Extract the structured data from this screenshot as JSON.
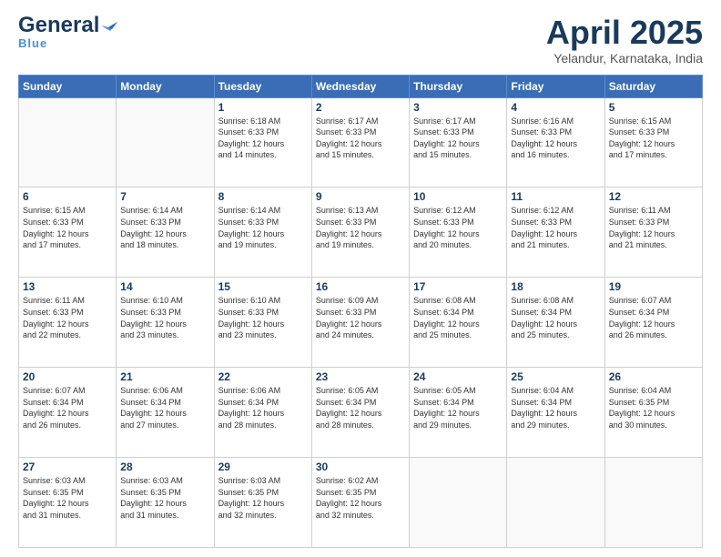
{
  "header": {
    "logo_line1": "General",
    "logo_line2": "Blue",
    "title": "April 2025",
    "subtitle": "Yelandur, Karnataka, India"
  },
  "weekdays": [
    "Sunday",
    "Monday",
    "Tuesday",
    "Wednesday",
    "Thursday",
    "Friday",
    "Saturday"
  ],
  "weeks": [
    [
      {
        "day": "",
        "info": ""
      },
      {
        "day": "",
        "info": ""
      },
      {
        "day": "1",
        "info": "Sunrise: 6:18 AM\nSunset: 6:33 PM\nDaylight: 12 hours\nand 14 minutes."
      },
      {
        "day": "2",
        "info": "Sunrise: 6:17 AM\nSunset: 6:33 PM\nDaylight: 12 hours\nand 15 minutes."
      },
      {
        "day": "3",
        "info": "Sunrise: 6:17 AM\nSunset: 6:33 PM\nDaylight: 12 hours\nand 15 minutes."
      },
      {
        "day": "4",
        "info": "Sunrise: 6:16 AM\nSunset: 6:33 PM\nDaylight: 12 hours\nand 16 minutes."
      },
      {
        "day": "5",
        "info": "Sunrise: 6:15 AM\nSunset: 6:33 PM\nDaylight: 12 hours\nand 17 minutes."
      }
    ],
    [
      {
        "day": "6",
        "info": "Sunrise: 6:15 AM\nSunset: 6:33 PM\nDaylight: 12 hours\nand 17 minutes."
      },
      {
        "day": "7",
        "info": "Sunrise: 6:14 AM\nSunset: 6:33 PM\nDaylight: 12 hours\nand 18 minutes."
      },
      {
        "day": "8",
        "info": "Sunrise: 6:14 AM\nSunset: 6:33 PM\nDaylight: 12 hours\nand 19 minutes."
      },
      {
        "day": "9",
        "info": "Sunrise: 6:13 AM\nSunset: 6:33 PM\nDaylight: 12 hours\nand 19 minutes."
      },
      {
        "day": "10",
        "info": "Sunrise: 6:12 AM\nSunset: 6:33 PM\nDaylight: 12 hours\nand 20 minutes."
      },
      {
        "day": "11",
        "info": "Sunrise: 6:12 AM\nSunset: 6:33 PM\nDaylight: 12 hours\nand 21 minutes."
      },
      {
        "day": "12",
        "info": "Sunrise: 6:11 AM\nSunset: 6:33 PM\nDaylight: 12 hours\nand 21 minutes."
      }
    ],
    [
      {
        "day": "13",
        "info": "Sunrise: 6:11 AM\nSunset: 6:33 PM\nDaylight: 12 hours\nand 22 minutes."
      },
      {
        "day": "14",
        "info": "Sunrise: 6:10 AM\nSunset: 6:33 PM\nDaylight: 12 hours\nand 23 minutes."
      },
      {
        "day": "15",
        "info": "Sunrise: 6:10 AM\nSunset: 6:33 PM\nDaylight: 12 hours\nand 23 minutes."
      },
      {
        "day": "16",
        "info": "Sunrise: 6:09 AM\nSunset: 6:33 PM\nDaylight: 12 hours\nand 24 minutes."
      },
      {
        "day": "17",
        "info": "Sunrise: 6:08 AM\nSunset: 6:34 PM\nDaylight: 12 hours\nand 25 minutes."
      },
      {
        "day": "18",
        "info": "Sunrise: 6:08 AM\nSunset: 6:34 PM\nDaylight: 12 hours\nand 25 minutes."
      },
      {
        "day": "19",
        "info": "Sunrise: 6:07 AM\nSunset: 6:34 PM\nDaylight: 12 hours\nand 26 minutes."
      }
    ],
    [
      {
        "day": "20",
        "info": "Sunrise: 6:07 AM\nSunset: 6:34 PM\nDaylight: 12 hours\nand 26 minutes."
      },
      {
        "day": "21",
        "info": "Sunrise: 6:06 AM\nSunset: 6:34 PM\nDaylight: 12 hours\nand 27 minutes."
      },
      {
        "day": "22",
        "info": "Sunrise: 6:06 AM\nSunset: 6:34 PM\nDaylight: 12 hours\nand 28 minutes."
      },
      {
        "day": "23",
        "info": "Sunrise: 6:05 AM\nSunset: 6:34 PM\nDaylight: 12 hours\nand 28 minutes."
      },
      {
        "day": "24",
        "info": "Sunrise: 6:05 AM\nSunset: 6:34 PM\nDaylight: 12 hours\nand 29 minutes."
      },
      {
        "day": "25",
        "info": "Sunrise: 6:04 AM\nSunset: 6:34 PM\nDaylight: 12 hours\nand 29 minutes."
      },
      {
        "day": "26",
        "info": "Sunrise: 6:04 AM\nSunset: 6:35 PM\nDaylight: 12 hours\nand 30 minutes."
      }
    ],
    [
      {
        "day": "27",
        "info": "Sunrise: 6:03 AM\nSunset: 6:35 PM\nDaylight: 12 hours\nand 31 minutes."
      },
      {
        "day": "28",
        "info": "Sunrise: 6:03 AM\nSunset: 6:35 PM\nDaylight: 12 hours\nand 31 minutes."
      },
      {
        "day": "29",
        "info": "Sunrise: 6:03 AM\nSunset: 6:35 PM\nDaylight: 12 hours\nand 32 minutes."
      },
      {
        "day": "30",
        "info": "Sunrise: 6:02 AM\nSunset: 6:35 PM\nDaylight: 12 hours\nand 32 minutes."
      },
      {
        "day": "",
        "info": ""
      },
      {
        "day": "",
        "info": ""
      },
      {
        "day": "",
        "info": ""
      }
    ]
  ]
}
